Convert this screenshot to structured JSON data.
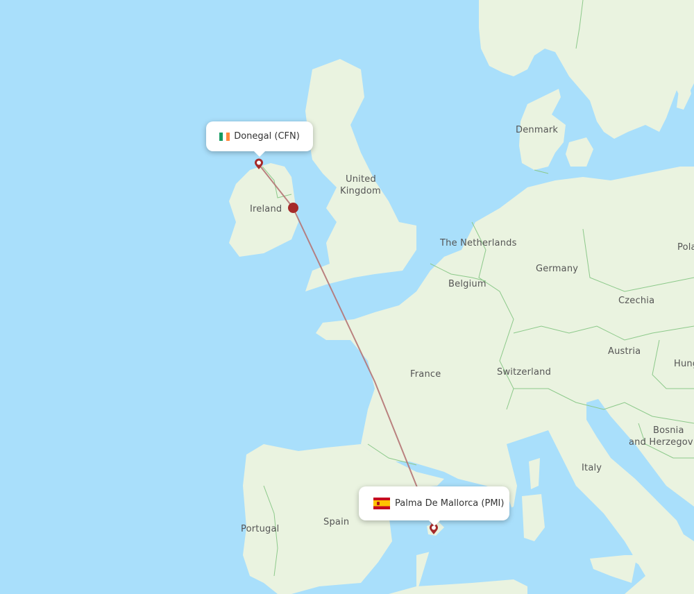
{
  "map": {
    "colors": {
      "water": "#a9dffb",
      "land": "#eaf3e0",
      "border": "#8cc98a",
      "route": "#b57474",
      "marker": "#a52a2a"
    },
    "origin": {
      "name": "Donegal",
      "code": "CFN",
      "label": "Donegal (CFN)",
      "country_flag": "ireland-flag",
      "flag_colors": [
        "#169b62",
        "#ffffff",
        "#ff883e"
      ]
    },
    "destination": {
      "name": "Palma De Mallorca",
      "code": "PMI",
      "label": "Palma De Mallorca (PMI)",
      "country_flag": "spain-flag"
    },
    "stopover_marker": "dublin-stop-dot",
    "country_labels": [
      {
        "id": "denmark",
        "text": "Denmark"
      },
      {
        "id": "united-kingdom-1",
        "text": "United"
      },
      {
        "id": "united-kingdom-2",
        "text": "Kingdom"
      },
      {
        "id": "ireland",
        "text": "Ireland"
      },
      {
        "id": "netherlands",
        "text": "The Netherlands"
      },
      {
        "id": "germany",
        "text": "Germany"
      },
      {
        "id": "belgium",
        "text": "Belgium"
      },
      {
        "id": "czechia",
        "text": "Czechia"
      },
      {
        "id": "poland",
        "text": "Pola"
      },
      {
        "id": "austria",
        "text": "Austria"
      },
      {
        "id": "hungary",
        "text": "Hung"
      },
      {
        "id": "france",
        "text": "France"
      },
      {
        "id": "switzerland",
        "text": "Switzerland"
      },
      {
        "id": "bosnia-1",
        "text": "Bosnia"
      },
      {
        "id": "bosnia-2",
        "text": "and Herzegov"
      },
      {
        "id": "italy",
        "text": "Italy"
      },
      {
        "id": "portugal",
        "text": "Portugal"
      },
      {
        "id": "spain",
        "text": "Spain"
      }
    ]
  }
}
